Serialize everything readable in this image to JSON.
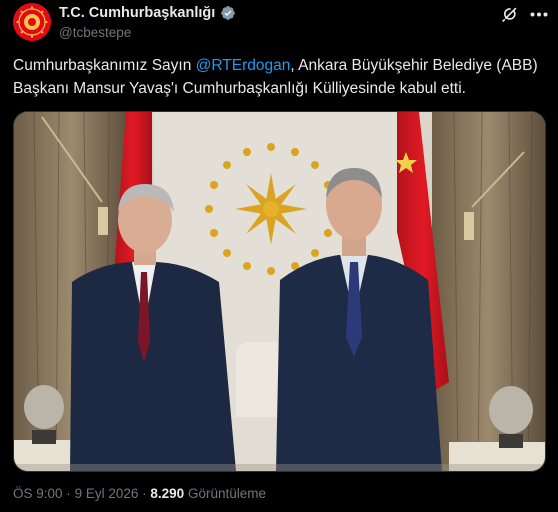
{
  "author": {
    "display_name": "T.C. Cumhurbaşkanlığı",
    "handle": "@tcbestepe"
  },
  "tweet": {
    "text_before": "Cumhurbaşkanımız Sayın ",
    "mention": "@RTErdogan",
    "text_after": ", Ankara Büyükşehir Belediye (ABB) Başkanı Mansur Yavaş'ı Cumhurbaşkanlığı Külliyesinde kabul etti."
  },
  "meta": {
    "time": "ÖS 9:00",
    "separator": "·",
    "date": "9 Eyl 2026",
    "views_count": "8.290",
    "views_label": "Görüntüleme"
  },
  "colors": {
    "background": "#000000",
    "text": "#e7e9ea",
    "secondary_text": "#71767b",
    "link": "#1d9bf0",
    "flag_red": "#e30a17",
    "emblem_gold": "#d9a520"
  },
  "icons": {
    "avatar": "presidential-seal-icon",
    "verified": "verified-badge-icon",
    "grok": "grok-icon",
    "more": "more-options-icon"
  }
}
